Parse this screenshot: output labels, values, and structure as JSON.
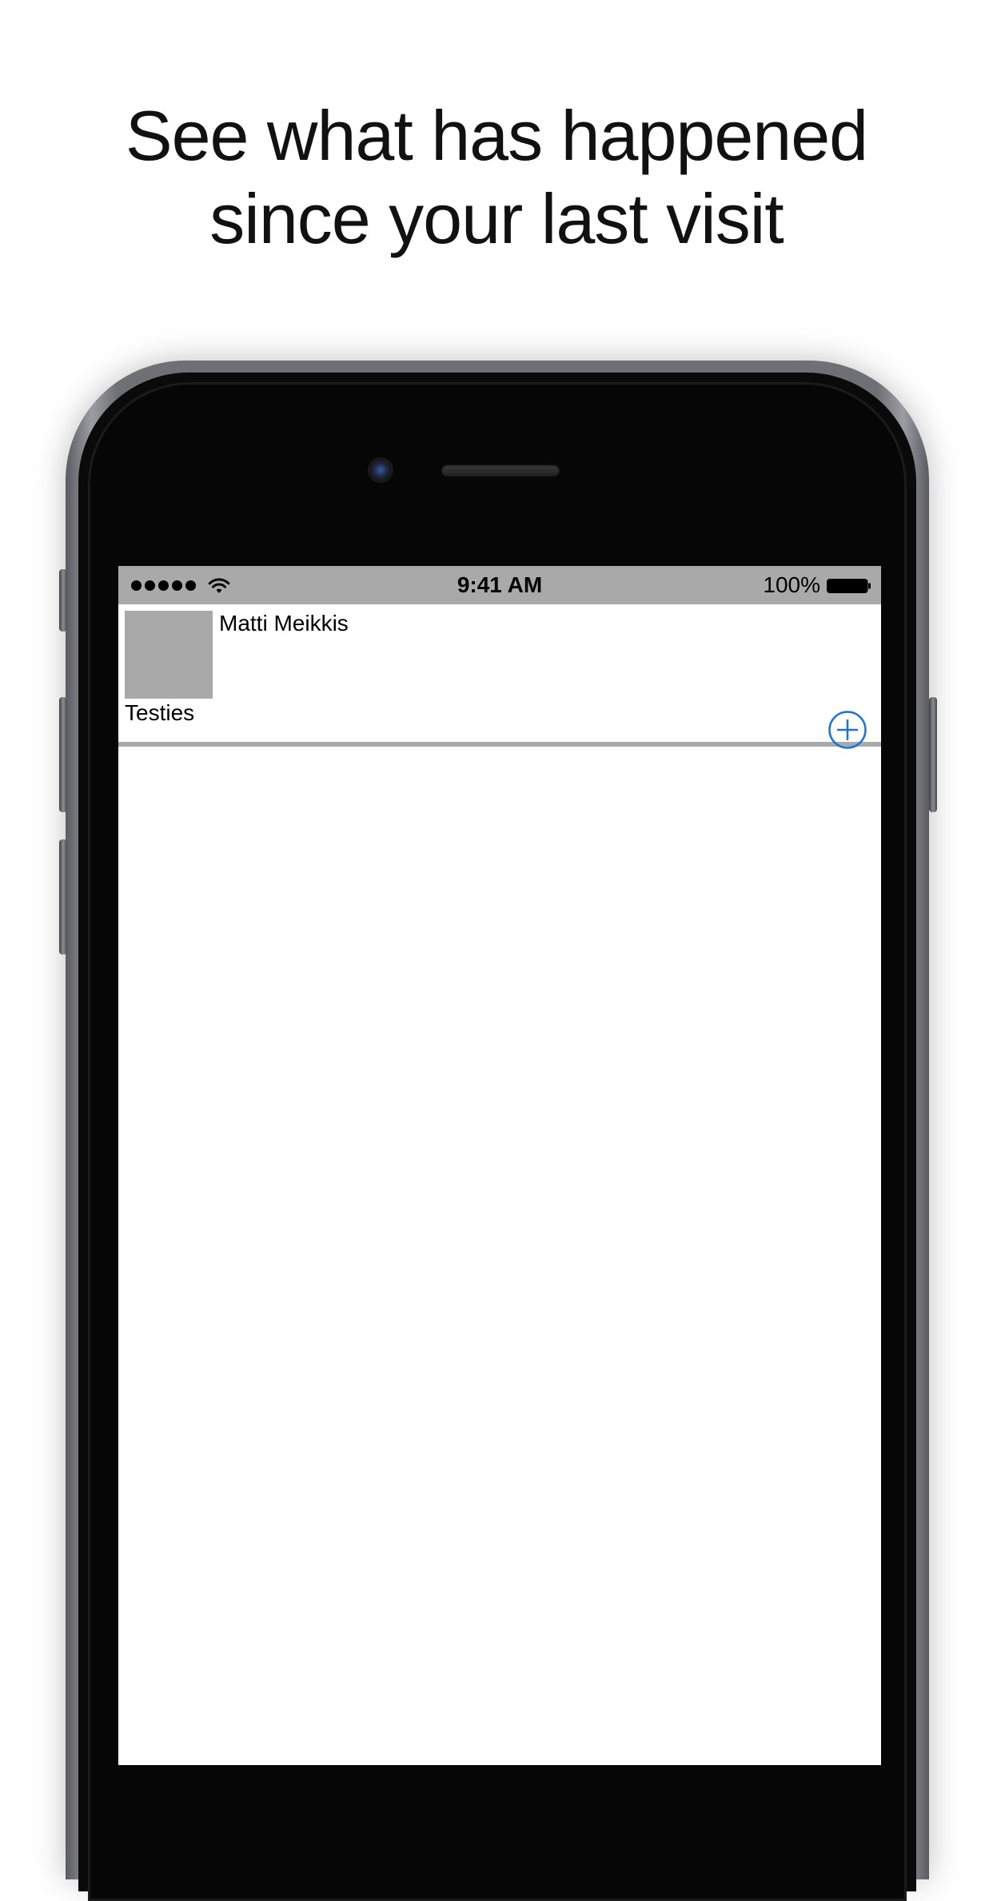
{
  "headline": {
    "line1": "See what has happened",
    "line2": "since your last visit"
  },
  "status_bar": {
    "time": "9:41 AM",
    "battery_percent": "100%",
    "battery_level": 1.0,
    "signal_bars": 5
  },
  "feed": {
    "items": [
      {
        "user_name": "Matti Meikkis",
        "text": "Testies"
      }
    ]
  },
  "icons": {
    "add": "plus-circle-icon",
    "wifi": "wifi-icon",
    "battery": "battery-icon",
    "signal": "signal-dots-icon"
  },
  "colors": {
    "accent": "#1a73d9",
    "placeholder_gray": "#a9a9a9",
    "status_bar_bg": "#a9a9a9"
  }
}
